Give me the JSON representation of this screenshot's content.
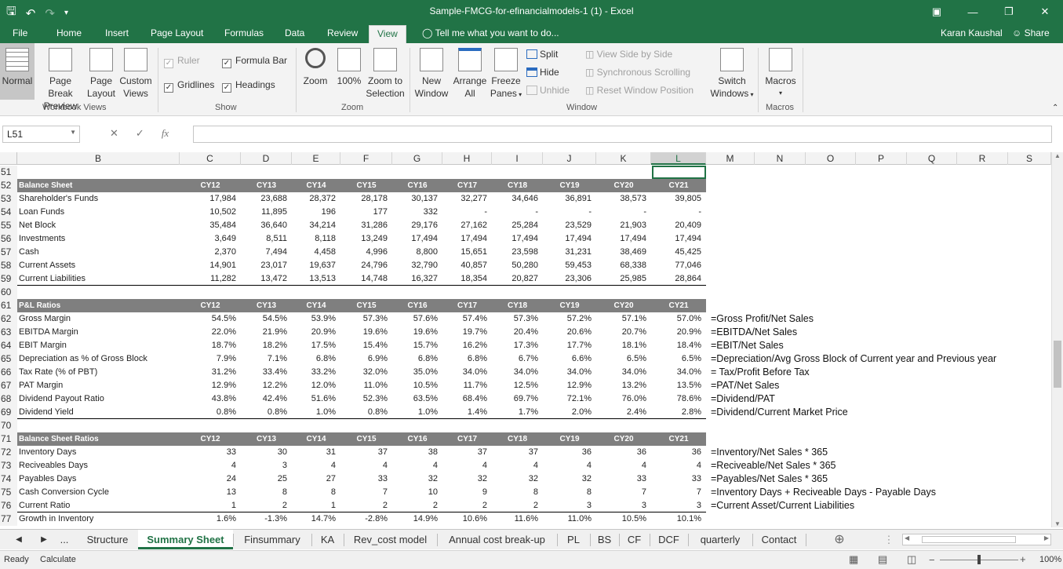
{
  "app": {
    "title": "Sample-FMCG-for-efinancialmodels-1 (1) - Excel",
    "user": "Karan Kaushal",
    "share": "Share",
    "tell_me": "Tell me what you want to do..."
  },
  "menu_tabs": [
    "File",
    "Home",
    "Insert",
    "Page Layout",
    "Formulas",
    "Data",
    "Review",
    "View"
  ],
  "active_tab": "View",
  "ribbon": {
    "workbook_views": {
      "label": "Workbook Views",
      "normal": "Normal",
      "page_break_1": "Page Break",
      "page_break_2": "Preview",
      "page_1": "Page",
      "page_2": "Layout",
      "custom_1": "Custom",
      "custom_2": "Views"
    },
    "show": {
      "label": "Show",
      "ruler": "Ruler",
      "formula_bar": "Formula Bar",
      "gridlines": "Gridlines",
      "headings": "Headings"
    },
    "zoom": {
      "label": "Zoom",
      "zoom": "Zoom",
      "hundred": "100%",
      "zts_1": "Zoom to",
      "zts_2": "Selection"
    },
    "window": {
      "label": "Window",
      "new_1": "New",
      "new_2": "Window",
      "arrange_1": "Arrange",
      "arrange_2": "All",
      "freeze_1": "Freeze",
      "freeze_2": "Panes",
      "split": "Split",
      "hide": "Hide",
      "unhide": "Unhide",
      "side_by_side": "View Side by Side",
      "sync_scroll": "Synchronous Scrolling",
      "reset_pos": "Reset Window Position",
      "switch_1": "Switch",
      "switch_2": "Windows"
    },
    "macros": {
      "label": "Macros",
      "macros": "Macros"
    }
  },
  "formula_bar": {
    "name_box": "L51",
    "formula": ""
  },
  "columns": [
    "B",
    "C",
    "D",
    "E",
    "F",
    "G",
    "H",
    "I",
    "J",
    "K",
    "L",
    "M",
    "N",
    "O",
    "P",
    "Q",
    "R",
    "S"
  ],
  "years": [
    "CY12",
    "CY13",
    "CY14",
    "CY15",
    "CY16",
    "CY17",
    "CY18",
    "CY19",
    "CY20",
    "CY21"
  ],
  "rows": [
    {
      "n": "51",
      "type": "blank"
    },
    {
      "n": "52",
      "type": "header",
      "label": "Balance Sheet"
    },
    {
      "n": "53",
      "type": "data",
      "label": "Shareholder's Funds",
      "v": [
        "17,984",
        "23,688",
        "28,372",
        "28,178",
        "30,137",
        "32,277",
        "34,646",
        "36,891",
        "38,573",
        "39,805"
      ]
    },
    {
      "n": "54",
      "type": "data",
      "label": "Loan Funds",
      "v": [
        "10,502",
        "11,895",
        "196",
        "177",
        "332",
        "-",
        "-",
        "-",
        "-",
        "-"
      ]
    },
    {
      "n": "55",
      "type": "data",
      "label": "Net Block",
      "v": [
        "35,484",
        "36,640",
        "34,214",
        "31,286",
        "29,176",
        "27,162",
        "25,284",
        "23,529",
        "21,903",
        "20,409"
      ]
    },
    {
      "n": "56",
      "type": "data",
      "label": "Investments",
      "v": [
        "3,649",
        "8,511",
        "8,118",
        "13,249",
        "17,494",
        "17,494",
        "17,494",
        "17,494",
        "17,494",
        "17,494"
      ]
    },
    {
      "n": "57",
      "type": "data",
      "label": "Cash",
      "v": [
        "2,370",
        "7,494",
        "4,458",
        "4,996",
        "8,800",
        "15,651",
        "23,598",
        "31,231",
        "38,469",
        "45,425"
      ]
    },
    {
      "n": "58",
      "type": "data",
      "label": "Current Assets",
      "v": [
        "14,901",
        "23,017",
        "19,637",
        "24,796",
        "32,790",
        "40,857",
        "50,280",
        "59,453",
        "68,338",
        "77,046"
      ]
    },
    {
      "n": "59",
      "type": "data",
      "label": "Current Liabilities",
      "v": [
        "11,282",
        "13,472",
        "13,513",
        "14,748",
        "16,327",
        "18,354",
        "20,827",
        "23,306",
        "25,985",
        "28,864"
      ],
      "underline": true
    },
    {
      "n": "60",
      "type": "blank"
    },
    {
      "n": "61",
      "type": "header",
      "label": "P&L Ratios"
    },
    {
      "n": "62",
      "type": "data",
      "label": "Gross Margin",
      "v": [
        "54.5%",
        "54.5%",
        "53.9%",
        "57.3%",
        "57.6%",
        "57.4%",
        "57.3%",
        "57.2%",
        "57.1%",
        "57.0%"
      ],
      "note": "=Gross Profit/Net Sales"
    },
    {
      "n": "63",
      "type": "data",
      "label": "EBITDA Margin",
      "v": [
        "22.0%",
        "21.9%",
        "20.9%",
        "19.6%",
        "19.6%",
        "19.7%",
        "20.4%",
        "20.6%",
        "20.7%",
        "20.9%"
      ],
      "note": "=EBITDA/Net Sales"
    },
    {
      "n": "64",
      "type": "data",
      "label": "EBIT Margin",
      "v": [
        "18.7%",
        "18.2%",
        "17.5%",
        "15.4%",
        "15.7%",
        "16.2%",
        "17.3%",
        "17.7%",
        "18.1%",
        "18.4%"
      ],
      "note": "=EBIT/Net Sales"
    },
    {
      "n": "65",
      "type": "data",
      "label": "Depreciation as % of Gross Block",
      "v": [
        "7.9%",
        "7.1%",
        "6.8%",
        "6.9%",
        "6.8%",
        "6.8%",
        "6.7%",
        "6.6%",
        "6.5%",
        "6.5%"
      ],
      "note": "=Depreciation/Avg Gross Block of Current year and Previous year"
    },
    {
      "n": "66",
      "type": "data",
      "label": "Tax Rate (% of PBT)",
      "v": [
        "31.2%",
        "33.4%",
        "33.2%",
        "32.0%",
        "35.0%",
        "34.0%",
        "34.0%",
        "34.0%",
        "34.0%",
        "34.0%"
      ],
      "note": "= Tax/Profit Before Tax"
    },
    {
      "n": "67",
      "type": "data",
      "label": "PAT Margin",
      "v": [
        "12.9%",
        "12.2%",
        "12.0%",
        "11.0%",
        "10.5%",
        "11.7%",
        "12.5%",
        "12.9%",
        "13.2%",
        "13.5%"
      ],
      "note": "=PAT/Net Sales"
    },
    {
      "n": "68",
      "type": "data",
      "label": "Dividend Payout Ratio",
      "v": [
        "43.8%",
        "42.4%",
        "51.6%",
        "52.3%",
        "63.5%",
        "68.4%",
        "69.7%",
        "72.1%",
        "76.0%",
        "78.6%"
      ],
      "note": "=Dividend/PAT"
    },
    {
      "n": "69",
      "type": "data",
      "label": "Dividend Yield",
      "v": [
        "0.8%",
        "0.8%",
        "1.0%",
        "0.8%",
        "1.0%",
        "1.4%",
        "1.7%",
        "2.0%",
        "2.4%",
        "2.8%"
      ],
      "note": "=Dividend/Current Market Price",
      "underline": true
    },
    {
      "n": "70",
      "type": "blank"
    },
    {
      "n": "71",
      "type": "header",
      "label": "Balance Sheet Ratios"
    },
    {
      "n": "72",
      "type": "data",
      "label": "Inventory Days",
      "v": [
        "33",
        "30",
        "31",
        "37",
        "38",
        "37",
        "37",
        "36",
        "36",
        "36"
      ],
      "note": "=Inventory/Net Sales * 365"
    },
    {
      "n": "73",
      "type": "data",
      "label": "Reciveables Days",
      "v": [
        "4",
        "3",
        "4",
        "4",
        "4",
        "4",
        "4",
        "4",
        "4",
        "4"
      ],
      "note": "=Reciveable/Net Sales * 365"
    },
    {
      "n": "74",
      "type": "data",
      "label": "Payables Days",
      "v": [
        "24",
        "25",
        "27",
        "33",
        "32",
        "32",
        "32",
        "32",
        "33",
        "33"
      ],
      "note": "=Payables/Net Sales * 365"
    },
    {
      "n": "75",
      "type": "data",
      "label": "Cash Conversion Cycle",
      "v": [
        "13",
        "8",
        "8",
        "7",
        "10",
        "9",
        "8",
        "8",
        "7",
        "7"
      ],
      "note": "=Inventory Days + Reciveable Days - Payable Days"
    },
    {
      "n": "76",
      "type": "data",
      "label": "Current Ratio",
      "v": [
        "1",
        "2",
        "1",
        "2",
        "2",
        "2",
        "2",
        "3",
        "3",
        "3"
      ],
      "note": "=Current Asset/Current Liabilities",
      "underline": true
    },
    {
      "n": "77",
      "type": "data",
      "label": "Growth in Inventory",
      "v": [
        "1.6%",
        "-1.3%",
        "14.7%",
        "-2.8%",
        "14.9%",
        "10.6%",
        "11.6%",
        "11.0%",
        "10.5%",
        "10.1%"
      ]
    }
  ],
  "sheet_tabs": [
    "Structure",
    "Summary Sheet",
    "Finsummary",
    "KA",
    "Rev_cost model",
    "Annual cost break-up",
    "PL",
    "BS",
    "CF",
    "DCF",
    "quarterly",
    "Contact"
  ],
  "active_sheet": "Summary Sheet",
  "status": {
    "ready": "Ready",
    "calculate": "Calculate",
    "zoom": "100%"
  }
}
